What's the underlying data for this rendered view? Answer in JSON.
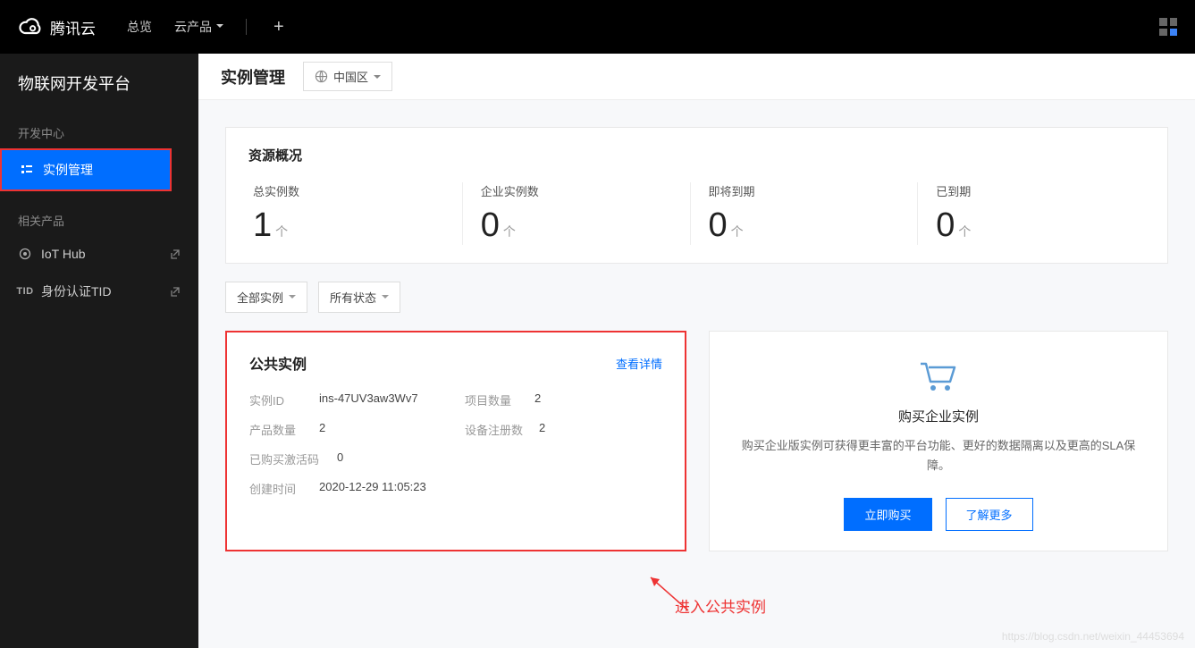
{
  "topbar": {
    "brand": "腾讯云",
    "nav": {
      "overview": "总览",
      "products": "云产品"
    }
  },
  "sidebar": {
    "title": "物联网开发平台",
    "section_dev": "开发中心",
    "item_instance": "实例管理",
    "section_related": "相关产品",
    "item_iothub": "IoT Hub",
    "item_tid": "身份认证TID",
    "tid_badge": "TID"
  },
  "header": {
    "title": "实例管理",
    "region": "中国区"
  },
  "overview": {
    "title": "资源概况",
    "stats": [
      {
        "label": "总实例数",
        "value": "1",
        "unit": "个"
      },
      {
        "label": "企业实例数",
        "value": "0",
        "unit": "个"
      },
      {
        "label": "即将到期",
        "value": "0",
        "unit": "个"
      },
      {
        "label": "已到期",
        "value": "0",
        "unit": "个"
      }
    ]
  },
  "filters": {
    "instance_type": "全部实例",
    "status": "所有状态"
  },
  "instance": {
    "title": "公共实例",
    "detail_link": "查看详情",
    "fields": {
      "id_label": "实例ID",
      "id_value": "ins-47UV3aw3Wv7",
      "proj_label": "项目数量",
      "proj_value": "2",
      "prod_label": "产品数量",
      "prod_value": "2",
      "dev_label": "设备注册数",
      "dev_value": "2",
      "code_label": "已购买激活码",
      "code_value": "0",
      "time_label": "创建时间",
      "time_value": "2020-12-29 11:05:23"
    }
  },
  "buy": {
    "title": "购买企业实例",
    "desc": "购买企业版实例可获得更丰富的平台功能、更好的数据隔离以及更高的SLA保障。",
    "primary": "立即购买",
    "secondary": "了解更多"
  },
  "annotation": "进入公共实例",
  "watermark": "https://blog.csdn.net/weixin_44453694"
}
